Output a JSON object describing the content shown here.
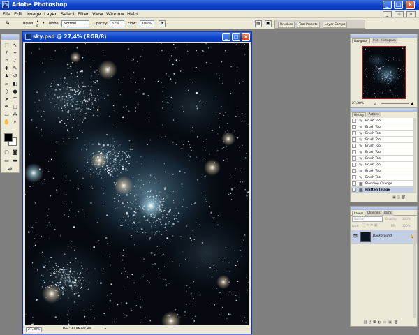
{
  "app": {
    "title": "Adobe Photoshop"
  },
  "menu": [
    "File",
    "Edit",
    "Image",
    "Layer",
    "Select",
    "Filter",
    "View",
    "Window",
    "Help"
  ],
  "options": {
    "brush_label": "Brush:",
    "brush_size": "9",
    "mode_label": "Mode:",
    "mode_value": "Normal",
    "opacity_label": "Opacity:",
    "opacity_value": "67%",
    "flow_label": "Flow:",
    "flow_value": "100%",
    "palette_tabs": [
      "Brushes",
      "Tool Presets",
      "Layer Comps"
    ]
  },
  "document": {
    "title": "sky.psd @ 27,4% (RGB/8)",
    "zoom": "27,38%",
    "doc_size": "Doc: 32,8M/32,8M"
  },
  "navigator": {
    "tabs": [
      "Navigator",
      "Info",
      "Histogram"
    ],
    "zoom": "27,38%"
  },
  "history": {
    "tabs": [
      "History",
      "Actions"
    ],
    "items": [
      "Brush Tool",
      "Brush Tool",
      "Brush Tool",
      "Brush Tool",
      "Brush Tool",
      "Brush Tool",
      "Brush Tool",
      "Brush Tool",
      "Brush Tool",
      "Brush Tool",
      "Blending Change",
      "Flatten Image"
    ]
  },
  "layers": {
    "tabs": [
      "Layers",
      "Channels",
      "Paths"
    ],
    "blend_mode": "Normal",
    "opacity_label": "Opacity:",
    "opacity_value": "100%",
    "lock_label": "Lock:",
    "fill_label": "Fill:",
    "fill_value": "100%",
    "layer_name": "Background"
  },
  "colors": {
    "title_blue": "#0a3fc8",
    "panel_bg": "#ece9d8",
    "workspace": "#7f7f7f",
    "selection": "#c1cee4"
  }
}
